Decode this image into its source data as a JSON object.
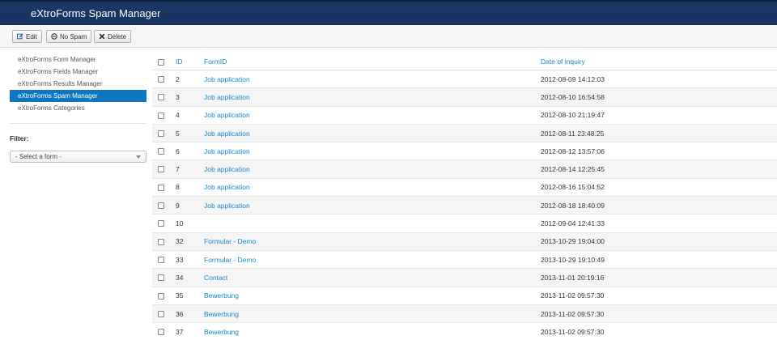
{
  "header": {
    "title": "eXtroForms Spam Manager"
  },
  "toolbar": {
    "edit_label": "Edit",
    "nospam_label": "No Spam",
    "delete_label": "Delete"
  },
  "sidebar": {
    "items": [
      {
        "label": "eXtroForms Form Manager"
      },
      {
        "label": "eXtroForms Fields Manager"
      },
      {
        "label": "eXtroForms Results Manager"
      },
      {
        "label": "eXtroForms Spam Manager",
        "active": true
      },
      {
        "label": "eXtroForms Categories"
      }
    ],
    "filter_label": "Filter:",
    "select_value": "- Select a form -"
  },
  "table": {
    "headers": {
      "id": "ID",
      "form": "FormID",
      "date": "Date of inquiry"
    },
    "rows": [
      {
        "id": "2",
        "form": "Job application",
        "date": "2012-08-09 14:12:03"
      },
      {
        "id": "3",
        "form": "Job application",
        "date": "2012-08-10 16:54:58"
      },
      {
        "id": "4",
        "form": "Job application",
        "date": "2012-08-10 21:19:47"
      },
      {
        "id": "5",
        "form": "Job application",
        "date": "2012-08-11 23:48:25"
      },
      {
        "id": "6",
        "form": "Job application",
        "date": "2012-08-12 13:57:06"
      },
      {
        "id": "7",
        "form": "Job application",
        "date": "2012-08-14 12:25:45"
      },
      {
        "id": "8",
        "form": "Job application",
        "date": "2012-08-16 15:04:52"
      },
      {
        "id": "9",
        "form": "Job application",
        "date": "2012-08-18 18:40:09"
      },
      {
        "id": "10",
        "form": "",
        "date": "2012-09-04 12:41:33"
      },
      {
        "id": "32",
        "form": "Formular - Demo",
        "date": "2013-10-29 19:04:00"
      },
      {
        "id": "33",
        "form": "Formular - Demo",
        "date": "2013-10-29 19:10:49"
      },
      {
        "id": "34",
        "form": "Contact",
        "date": "2013-11-01 20:19:16"
      },
      {
        "id": "35",
        "form": "Bewerbung",
        "date": "2013-11-02 09:57:30"
      },
      {
        "id": "36",
        "form": "Bewerbung",
        "date": "2013-11-02 09:57:30"
      },
      {
        "id": "37",
        "form": "Bewerbung",
        "date": "2013-11-02 09:57:30"
      }
    ]
  },
  "colors": {
    "header_bg": "#17335f",
    "accent": "#0e76bf",
    "link": "#1a87c9"
  }
}
